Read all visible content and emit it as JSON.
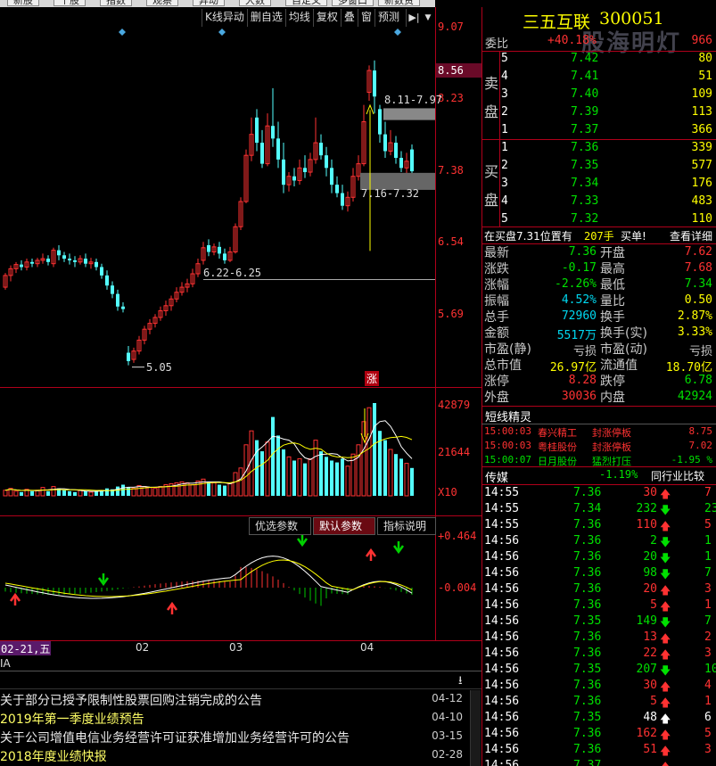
{
  "top_tabs": [
    "新股",
    "个股",
    "指数",
    "观察",
    "异动",
    "大数",
    "自定义",
    "多窗口",
    "新数资"
  ],
  "chart_toolbar": [
    "K线异动",
    "删自选",
    "均线",
    "复权",
    "叠",
    "窗",
    "预测"
  ],
  "stock": {
    "name": "三五互联",
    "code": "300051"
  },
  "watermark": "股海明灯",
  "price_axis": [
    "9.07",
    "8.56",
    "8.23",
    "7.38",
    "6.54",
    "5.69"
  ],
  "volume_axis": [
    "42879",
    "21644",
    "X10"
  ],
  "macd_axis": [
    "+0.464",
    "-0.004"
  ],
  "annotations": {
    "range_high": "8.11-7.97",
    "range_mid": "7.16-7.32",
    "range_low": "6.22-6.25",
    "low_mark": "5.05",
    "zhang": "涨"
  },
  "macd_tabs": [
    "优选参数",
    "默认参数",
    "指标说明"
  ],
  "x_axis": [
    "02-21,五",
    "02",
    "03",
    "04"
  ],
  "period_label": "IA",
  "news": [
    {
      "title": "关于部分已授予限制性股票回购注销完成的公告",
      "date": "04-12"
    },
    {
      "title": "2019年第一季度业绩预告",
      "date": "04-10"
    },
    {
      "title": "关于公司增值电信业务经营许可证获准增加业务经营许可的公告",
      "date": "03-15"
    },
    {
      "title": "2018年度业绩快报",
      "date": "02-28"
    }
  ],
  "order_book": {
    "weibi_label": "委比",
    "weibi_value": "+40.18%",
    "weicha": "966",
    "sell_label": [
      "卖",
      "盘"
    ],
    "buy_label": [
      "买",
      "盘"
    ],
    "sells": [
      {
        "level": "5",
        "price": "7.42",
        "vol": "80"
      },
      {
        "level": "4",
        "price": "7.41",
        "vol": "51"
      },
      {
        "level": "3",
        "price": "7.40",
        "vol": "109"
      },
      {
        "level": "2",
        "price": "7.39",
        "vol": "113"
      },
      {
        "level": "1",
        "price": "7.37",
        "vol": "366"
      }
    ],
    "buys": [
      {
        "level": "1",
        "price": "7.36",
        "vol": "339"
      },
      {
        "level": "2",
        "price": "7.35",
        "vol": "577"
      },
      {
        "level": "3",
        "price": "7.34",
        "vol": "176"
      },
      {
        "level": "4",
        "price": "7.33",
        "vol": "483"
      },
      {
        "level": "5",
        "price": "7.32",
        "vol": "110"
      }
    ]
  },
  "info_bar": {
    "text": "在买盘7.31位置有",
    "vol": "207手",
    "action": "买单!",
    "link": "查看详细"
  },
  "quote_stats": [
    {
      "l1": "最新",
      "v1": "7.36",
      "c1": "green",
      "l2": "开盘",
      "v2": "7.62",
      "c2": "red"
    },
    {
      "l1": "涨跌",
      "v1": "-0.17",
      "c1": "green",
      "l2": "最高",
      "v2": "7.68",
      "c2": "red"
    },
    {
      "l1": "涨幅",
      "v1": "-2.26%",
      "c1": "green",
      "l2": "最低",
      "v2": "7.34",
      "c2": "green"
    },
    {
      "l1": "振幅",
      "v1": "4.52%",
      "c1": "cyan",
      "l2": "量比",
      "v2": "0.50",
      "c2": "yellow"
    },
    {
      "l1": "总手",
      "v1": "72960",
      "c1": "cyan",
      "l2": "换手",
      "v2": "2.87%",
      "c2": "yellow"
    },
    {
      "l1": "金额",
      "v1": "5517万",
      "c1": "cyan",
      "l2": "换手(实)",
      "v2": "3.33%",
      "c2": "yellow"
    },
    {
      "l1": "市盈(静)",
      "v1": "亏损",
      "c1": "gray",
      "l2": "市盈(动)",
      "v2": "亏损",
      "c2": "gray"
    },
    {
      "l1": "总市值",
      "v1": "26.97亿",
      "c1": "yellow",
      "l2": "流通值",
      "v2": "18.70亿",
      "c2": "yellow"
    },
    {
      "l1": "涨停",
      "v1": "8.28",
      "c1": "red",
      "l2": "跌停",
      "v2": "6.78",
      "c2": "green"
    },
    {
      "l1": "外盘",
      "v1": "30036",
      "c1": "red",
      "l2": "内盘",
      "v2": "42924",
      "c2": "green"
    }
  ],
  "short_term": {
    "title": "短线精灵",
    "rows": [
      {
        "time": "15:00:03",
        "name": "春兴精工",
        "event": "封涨停板",
        "val": "8.75"
      },
      {
        "time": "15:00:03",
        "name": "粤桂股份",
        "event": "封涨停板",
        "val": "7.02"
      },
      {
        "time": "15:00:07",
        "name": "日月股份",
        "event": "猛烈打压",
        "val": "-1.95 %"
      }
    ]
  },
  "sector": {
    "name": "传媒",
    "change": "-1.19%",
    "compare": "同行业比较"
  },
  "ticks": [
    {
      "time": "14:55",
      "price": "7.36",
      "vol": "30",
      "dir": "up",
      "n": "7"
    },
    {
      "time": "14:55",
      "price": "7.34",
      "vol": "232",
      "dir": "down",
      "n": "23"
    },
    {
      "time": "14:55",
      "price": "7.36",
      "vol": "110",
      "dir": "up",
      "n": "5"
    },
    {
      "time": "14:56",
      "price": "7.36",
      "vol": "2",
      "dir": "down",
      "n": "1"
    },
    {
      "time": "14:56",
      "price": "7.36",
      "vol": "20",
      "dir": "down",
      "n": "1"
    },
    {
      "time": "14:56",
      "price": "7.36",
      "vol": "98",
      "dir": "down",
      "n": "7"
    },
    {
      "time": "14:56",
      "price": "7.36",
      "vol": "20",
      "dir": "up",
      "n": "3"
    },
    {
      "time": "14:56",
      "price": "7.36",
      "vol": "5",
      "dir": "up",
      "n": "1"
    },
    {
      "time": "14:56",
      "price": "7.35",
      "vol": "149",
      "dir": "down",
      "n": "7"
    },
    {
      "time": "14:56",
      "price": "7.36",
      "vol": "13",
      "dir": "up",
      "n": "2"
    },
    {
      "time": "14:56",
      "price": "7.36",
      "vol": "22",
      "dir": "up",
      "n": "3"
    },
    {
      "time": "14:56",
      "price": "7.35",
      "vol": "207",
      "dir": "down",
      "n": "10"
    },
    {
      "time": "14:56",
      "price": "7.36",
      "vol": "30",
      "dir": "up",
      "n": "4"
    },
    {
      "time": "14:56",
      "price": "7.36",
      "vol": "5",
      "dir": "up",
      "n": "1"
    },
    {
      "time": "14:56",
      "price": "7.35",
      "vol": "48",
      "dir": "neutral",
      "n": "6"
    },
    {
      "time": "14:56",
      "price": "7.36",
      "vol": "162",
      "dir": "up",
      "n": "5"
    },
    {
      "time": "14:56",
      "price": "7.36",
      "vol": "51",
      "dir": "up",
      "n": "3"
    },
    {
      "time": "14:56",
      "price": "7.37",
      "vol": "",
      "dir": "up",
      "n": ""
    }
  ]
}
